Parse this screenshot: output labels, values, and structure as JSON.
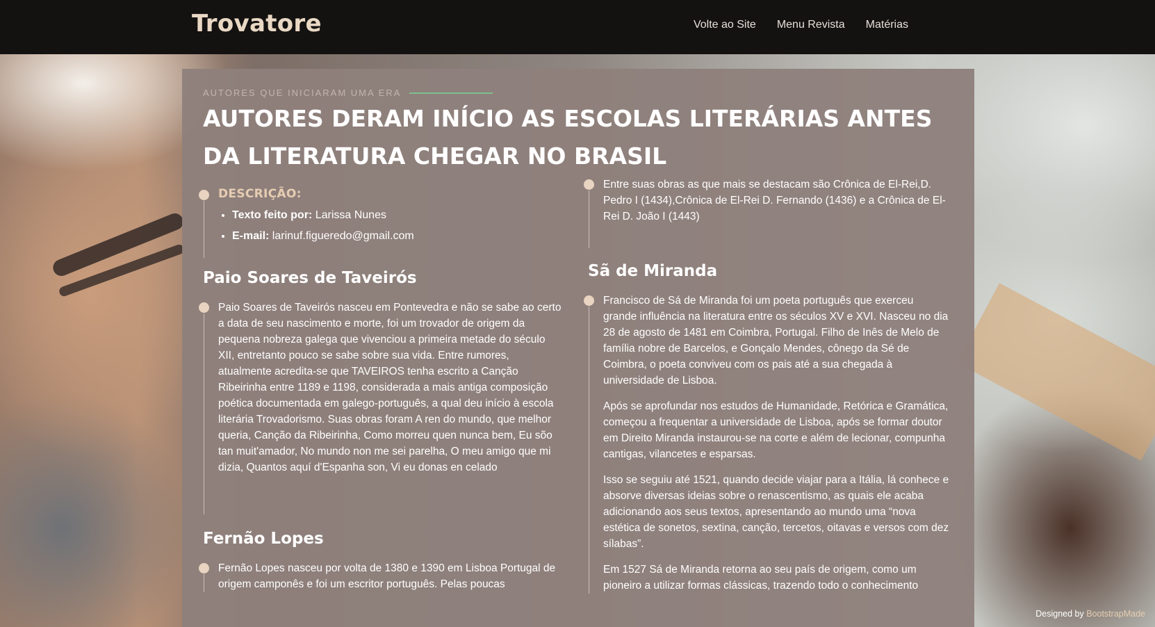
{
  "header": {
    "brand": "Trovatore",
    "nav": [
      "Volte ao Site",
      "Menu Revista",
      "Matérias"
    ]
  },
  "article": {
    "eyebrow": "AUTORES QUE INICIARAM UMA ERA",
    "title": "AUTORES DERAM INÍCIO AS ESCOLAS LITERÁRIAS ANTES DA LITERATURA CHEGAR NO BRASIL",
    "description": {
      "heading": "DESCRIÇÃO:",
      "author_label": "Texto feito por:",
      "author": "Larissa Nunes",
      "email_label": "E-mail:",
      "email": "larinuf.figueredo@gmail.com"
    },
    "sections_left": [
      {
        "title": "Paio Soares de Taveirós",
        "paragraphs": [
          "Paio Soares de Taveirós nasceu em Pontevedra e não se sabe ao certo a data de seu nascimento e morte, foi um trovador de origem da pequena nobreza galega que vivenciou a primeira metade do século XII, entretanto pouco se sabe sobre sua vida. Entre rumores, atualmente acredita-se que TAVEIROS tenha escrito a Canção Ribeirinha entre 1189 e 1198, considerada a mais antiga composição poética documentada em galego-português, a qual deu início à escola literária Trovadorismo. Suas obras foram A ren do mundo, que melhor queria, Canção da Ribeirinha, Como morreu quen nunca bem, Eu sõo tan muit'amador, No mundo non me sei parelha, O meu amigo que mi dizia, Quantos aquí d'Espanha son, Vi eu donas en celado"
        ]
      },
      {
        "title": "Fernão Lopes",
        "paragraphs": [
          "Fernão Lopes nasceu por volta de 1380 e 1390 em Lisboa Portugal de origem camponês e foi um escritor português. Pelas poucas"
        ]
      }
    ],
    "right_intro": "Entre suas obras as que mais se destacam são Crônica de El-Rei,D. Pedro I (1434),Crônica de El-Rei D. Fernando (1436) e a Crônica de El-Rei D. João I (1443)",
    "sections_right": [
      {
        "title": "Sã de Miranda",
        "paragraphs": [
          "Francisco de Sá de Miranda foi um poeta português que exerceu grande influência na literatura entre os séculos XV e XVI. Nasceu no dia 28 de agosto de 1481 em Coimbra, Portugal. Filho de Inês de Melo de família nobre de Barcelos, e Gonçalo Mendes, cônego da Sé de Coimbra, o poeta conviveu com os pais até a sua chegada à universidade de Lisboa.",
          "Após se aprofundar nos estudos de Humanidade, Retórica e Gramática, começou a frequentar a universidade de Lisboa, após se formar doutor em Direito Miranda instaurou-se na corte e além de lecionar, compunha cantigas, vilancetes e esparsas.",
          "Isso se seguiu até 1521, quando decide viajar para a Itália, lá conhece e absorve diversas ideias sobre o renascentismo, as quais ele acaba adicionando aos seus textos, apresentando ao mundo uma “nova estética de sonetos, sextina, canção, tercetos, oitavas e versos com dez sílabas”.",
          "Em 1527 Sá de Miranda retorna ao seu país de origem, como um pioneiro a utilizar formas clássicas, trazendo todo o conhecimento"
        ]
      }
    ]
  },
  "footer": {
    "designed_by": "Designed by",
    "credit_link": "BootstrapMade"
  }
}
